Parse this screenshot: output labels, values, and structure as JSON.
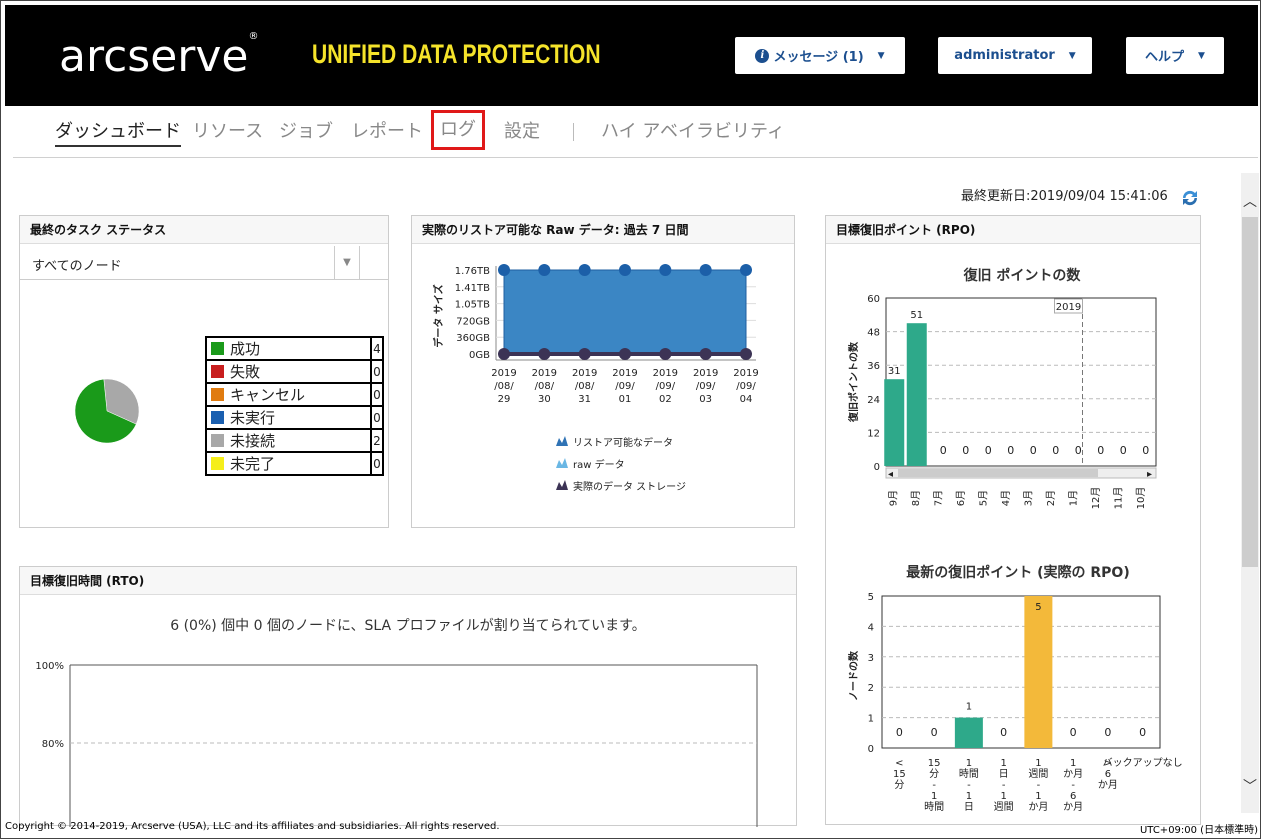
{
  "header": {
    "brand": "arcserve",
    "product": "UNIFIED DATA PROTECTION",
    "messages_label": "メッセージ (1)",
    "user_label": "administrator",
    "help_label": "ヘルプ"
  },
  "nav": {
    "tabs": [
      "ダッシュボード",
      "リソース",
      "ジョブ",
      "レポート",
      "ログ",
      "設定",
      "ハイ アベイラビリティ"
    ]
  },
  "last_updated": "最終更新日:2019/09/04 15:41:06",
  "task_status": {
    "title": "最終のタスク ステータス",
    "dropdown_value": "すべてのノード",
    "items": [
      {
        "label": "成功",
        "count": "4",
        "color": "#1a9a1a"
      },
      {
        "label": "失敗",
        "count": "0",
        "color": "#c81e1e"
      },
      {
        "label": "キャンセル",
        "count": "0",
        "color": "#e07b10"
      },
      {
        "label": "未実行",
        "count": "0",
        "color": "#1a5fb0"
      },
      {
        "label": "未接続",
        "count": "2",
        "color": "#a8a8a8"
      },
      {
        "label": "未完了",
        "count": "0",
        "color": "#f5ee1a"
      }
    ]
  },
  "raw_data": {
    "title": "実際のリストア可能な Raw データ: 過去 7 日間",
    "ylabel": "データ サイズ",
    "legend": [
      "リストア可能なデータ",
      "raw データ",
      "実際のデータ ストレージ"
    ]
  },
  "rpo": {
    "title": "目標復旧ポイント (RPO)"
  },
  "rto": {
    "title": "目標復旧時間 (RTO)",
    "message": "6 (0%) 個中 0 個のノードに、SLA プロファイルが割り当てられています。"
  },
  "footer": {
    "copyright": "Copyright © 2014-2019, Arcserve (USA), LLC and its affiliates and subsidiaries. All rights reserved.",
    "timezone": "UTC+09:00 (日本標準時)"
  },
  "chart_data": [
    {
      "type": "pie",
      "categories": [
        "成功",
        "失敗",
        "キャンセル",
        "未実行",
        "未接続",
        "未完了"
      ],
      "values": [
        4,
        0,
        0,
        0,
        2,
        0
      ]
    },
    {
      "type": "area",
      "title": "実際のリストア可能な Raw データ: 過去 7 日間",
      "ylabel": "データ サイズ",
      "categories": [
        "2019/08/29",
        "2019/08/30",
        "2019/08/31",
        "2019/09/01",
        "2019/09/02",
        "2019/09/03",
        "2019/09/04"
      ],
      "yticks": [
        "1.76TB",
        "1.41TB",
        "1.05TB",
        "720GB",
        "360GB",
        "0GB"
      ],
      "series": [
        {
          "name": "リストア可能なデータ",
          "values": [
            1.76,
            1.76,
            1.76,
            1.76,
            1.76,
            1.76,
            1.76
          ]
        },
        {
          "name": "raw データ",
          "values": [
            0,
            0,
            0,
            0,
            0,
            0,
            0
          ]
        },
        {
          "name": "実際のデータ ストレージ",
          "values": [
            0,
            0,
            0,
            0,
            0,
            0,
            0
          ]
        }
      ]
    },
    {
      "type": "bar",
      "title": "復旧 ポイントの数",
      "ylabel": "復旧ポイントの数",
      "categories": [
        "9月",
        "8月",
        "7月",
        "6月",
        "5月",
        "4月",
        "3月",
        "2月",
        "1月",
        "12月",
        "11月",
        "10月"
      ],
      "values": [
        31,
        51,
        0,
        0,
        0,
        0,
        0,
        0,
        0,
        0,
        0,
        0
      ],
      "ylim": [
        0,
        60
      ],
      "yticks": [
        0,
        12,
        24,
        36,
        48,
        60
      ],
      "annotation": "2019"
    },
    {
      "type": "bar",
      "title": "最新の復旧ポイント (実際の RPO)",
      "ylabel": "ノードの数",
      "categories": [
        "< 15 分",
        "15 分 - 1 時間",
        "1 時間 - 1 日",
        "1 日 - 1 週間",
        "1 週間 - 1 か月",
        "1 か月 - 6 か月",
        "> 6 か月",
        "バックアップなし"
      ],
      "values": [
        0,
        0,
        1,
        0,
        5,
        0,
        0,
        0
      ],
      "colors": [
        "#2ea98a",
        "#2ea98a",
        "#2ea98a",
        "#2ea98a",
        "#f3b93a",
        "#2ea98a",
        "#2ea98a",
        "#2ea98a"
      ],
      "ylim": [
        0,
        5
      ],
      "yticks": [
        0,
        1,
        2,
        3,
        4,
        5
      ]
    },
    {
      "type": "bar",
      "title": "目標復旧時間 (RTO)",
      "yticks": [
        "100%",
        "80%"
      ]
    }
  ]
}
